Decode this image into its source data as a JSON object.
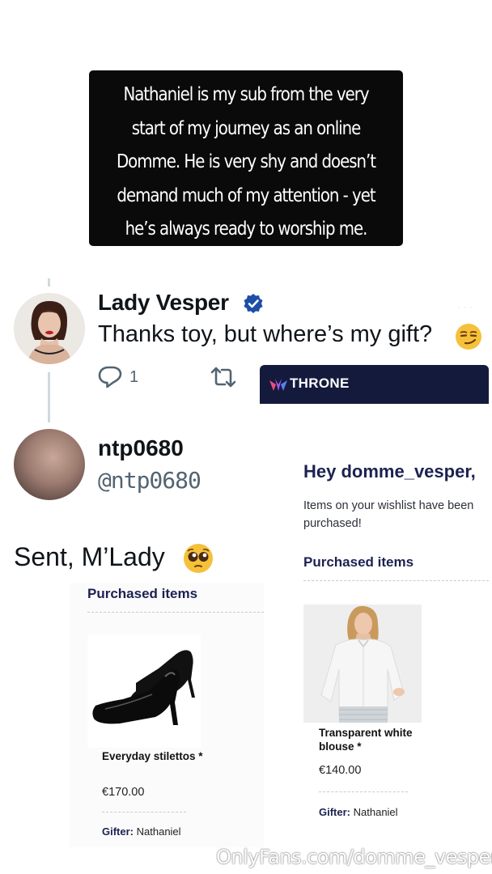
{
  "caption": {
    "lines": [
      "Nathaniel is my sub from the very",
      "start of my journey as an online",
      "Domme. He is very shy and doesn’t",
      "demand much of my attention - yet",
      "he’s always ready to worship me."
    ]
  },
  "tweet": {
    "author_name": "Lady Vesper",
    "text": "Thanks toy, but where’s my gift?",
    "reply_count": "1",
    "icons": [
      "verified-badge-icon",
      "smirk-emoji-icon",
      "reply-icon",
      "retweet-icon"
    ]
  },
  "reply": {
    "author_name": "ntp0680",
    "handle": "@ntp0680",
    "text": "Sent, M’Lady",
    "icons": [
      "pleading-face-emoji-icon"
    ]
  },
  "throne": {
    "brand": "THRONE",
    "greeting": "Hey domme_vesper,",
    "note": "Items on your wishlist have been purchased!",
    "section_title": "Purchased items",
    "item": {
      "name": "Transparent white blouse *",
      "price": "€140.00",
      "gifter_label": "Gifter:",
      "gifter_name": "Nathaniel"
    },
    "colors": {
      "header": "#141a3c",
      "accent": "#1c2150"
    }
  },
  "stiletto_card": {
    "section_title": "Purchased items",
    "item": {
      "name": "Everyday stilettos  *",
      "price": "€170.00",
      "gifter_label": "Gifter:",
      "gifter_name": "Nathaniel"
    }
  },
  "watermark": "OnlyFans.com/domme_vesper"
}
